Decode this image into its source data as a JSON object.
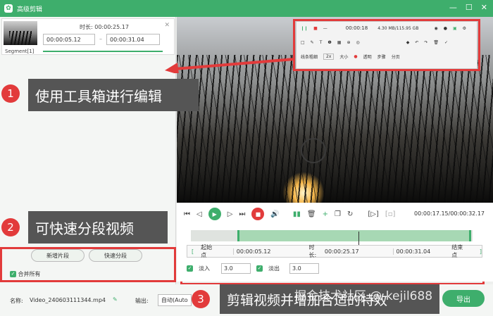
{
  "window": {
    "title": "高级剪辑",
    "minimize": "—",
    "maximize": "☐",
    "close": "✕"
  },
  "segment": {
    "label": "Segment[1]",
    "duration_label": "时长:",
    "duration": "00:00:25.17",
    "start": "00:00:05.12",
    "end": "00:00:31.04",
    "separator": "–"
  },
  "callouts": [
    {
      "num": "1",
      "text": "使用工具箱进行编辑"
    },
    {
      "num": "2",
      "text": "可快速分段视频"
    },
    {
      "num": "3",
      "text": "剪辑视频并增加合适的特效"
    }
  ],
  "left_buttons": {
    "new_segment": "新增片段",
    "quick_split": "快速分段",
    "merge_all": "合并所有"
  },
  "toolbox": {
    "record_time": "00:00:18",
    "size_info": "4.30 MB/115.95 GB",
    "line_width": "2x",
    "label_a": "线条粗细",
    "label_b": "大小",
    "label_c": "透明",
    "label_d": "步骤",
    "label_e": "分页"
  },
  "player": {
    "current_time": "00:00:17.15",
    "total_time": "00:00:32.17",
    "time_sep": "/"
  },
  "edit": {
    "start_label": "起始点",
    "start_value": "00:00:05.12",
    "duration_label": "时长:",
    "duration_value": "00:00:25.17",
    "end_value": "00:00:31.04",
    "end_label": "结束点",
    "fade_in_label": "淡入",
    "fade_in_value": "3.0",
    "fade_out_label": "淡出",
    "fade_out_value": "3.0"
  },
  "bottom": {
    "name_label": "名称:",
    "filename": "Video_240603111344.mp4",
    "output_label": "输出:",
    "output_value": "自动(Auto",
    "export_label": "导出"
  },
  "watermark": "掘金技术社区 @ kejil688",
  "colors": {
    "accent": "#3eae6c",
    "highlight": "#e23b3b",
    "callout_bg": "#555555"
  }
}
